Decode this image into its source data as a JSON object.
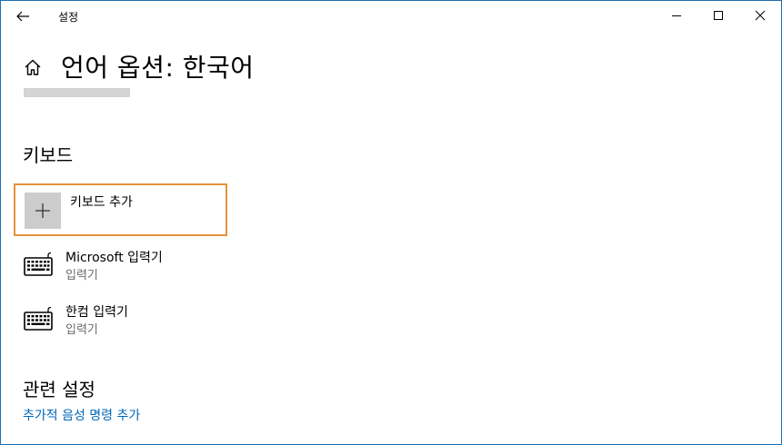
{
  "window": {
    "title": "설정",
    "icons": {
      "back": "back-arrow-icon",
      "minimize": "minimize-icon",
      "maximize": "maximize-icon",
      "close": "close-icon"
    }
  },
  "header": {
    "home_icon": "home-icon",
    "title": "언어 옵션: 한국어"
  },
  "keyboard_section": {
    "title": "키보드",
    "add_label": "키보드 추가",
    "add_icon": "plus-icon",
    "items": [
      {
        "name": "Microsoft 입력기",
        "type": "입력기",
        "icon": "keyboard-icon"
      },
      {
        "name": "한컴 입력기",
        "type": "입력기",
        "icon": "keyboard-icon"
      }
    ]
  },
  "related_section": {
    "title": "관련 설정",
    "link": "추가적 음성 명령 추가"
  },
  "colors": {
    "accent_link": "#0067b8",
    "focus_border": "#e4923a",
    "window_border": "#1f6fb2"
  }
}
